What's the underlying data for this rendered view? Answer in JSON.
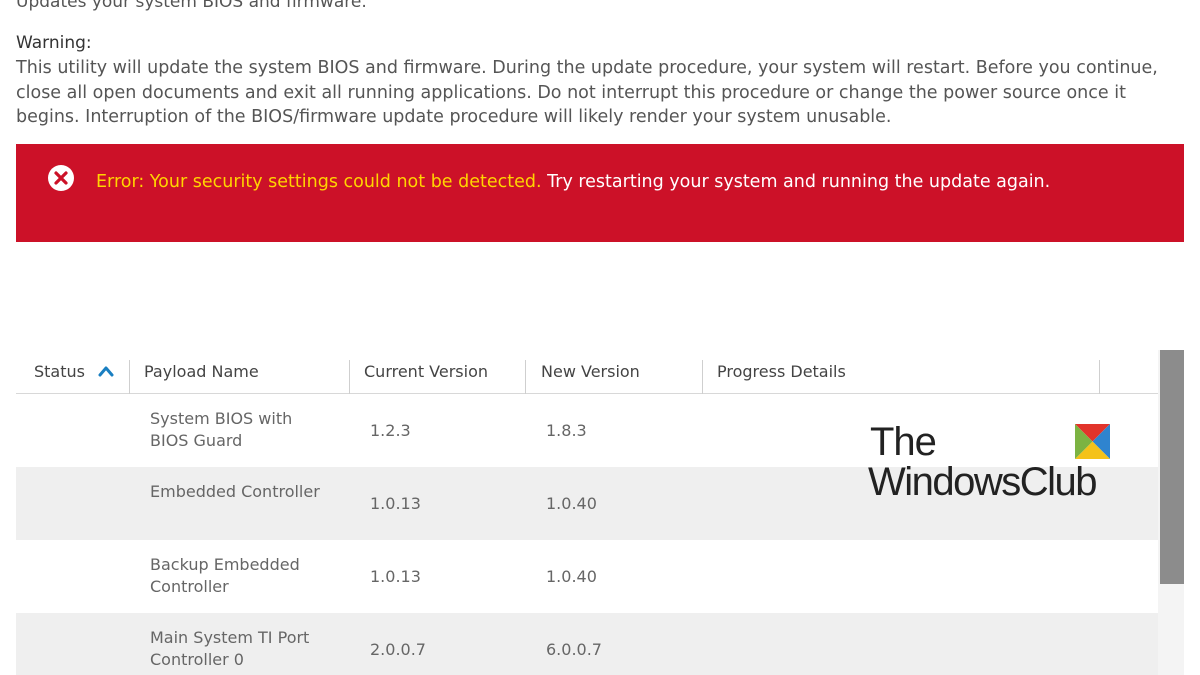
{
  "header": {
    "subtitle": "Updates your system BIOS and firmware."
  },
  "warning": {
    "heading": "Warning:",
    "body": "This utility will update the system BIOS and firmware. During the update procedure, your system will restart. Before you continue, close all open documents and exit all running applications. Do not interrupt this procedure or change the power source once it begins. Interruption of the BIOS/firmware update procedure will likely render your system unusable."
  },
  "error": {
    "icon": "error-circle-x-icon",
    "label": "Error: Your security settings could not be detected.",
    "message": " Try restarting your system and running the update again.",
    "colors": {
      "banner": "#cc1128",
      "label": "#ffd500"
    }
  },
  "table": {
    "columns": [
      "Status",
      "Payload Name",
      "Current Version",
      "New Version",
      "Progress Details"
    ],
    "sort": {
      "column": "Status",
      "direction": "ascending",
      "icon": "chevron-up-icon",
      "color": "#1a7fc1"
    },
    "rows": [
      {
        "status": "",
        "name": "System BIOS with BIOS Guard",
        "current": "1.2.3",
        "new": "1.8.3",
        "progress": ""
      },
      {
        "status": "",
        "name": "Embedded Controller",
        "current": "1.0.13",
        "new": "1.0.40",
        "progress": ""
      },
      {
        "status": "",
        "name": "Backup Embedded Controller",
        "current": "1.0.13",
        "new": "1.0.40",
        "progress": ""
      },
      {
        "status": "",
        "name": "Main System TI Port Controller 0",
        "current": "2.0.0.7",
        "new": "6.0.0.7",
        "progress": ""
      }
    ]
  },
  "watermark": {
    "line1": "The",
    "line2": "WindowsClub",
    "logo": "windows-club-logo-icon"
  }
}
